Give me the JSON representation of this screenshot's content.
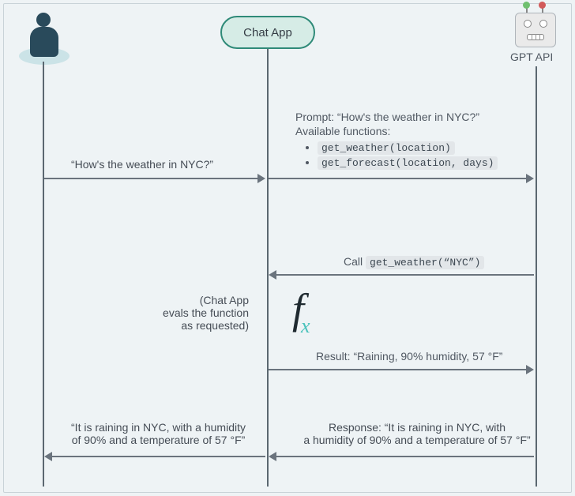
{
  "actors": {
    "user_label": "",
    "chat_app_label": "Chat App",
    "api_label": "GPT API"
  },
  "msg": {
    "user_to_app": "“How's the weather in NYC?”",
    "app_to_api_prompt": "Prompt: “How's the weather in NYC?”",
    "available_functions_label": "Available functions:",
    "func1": "get_weather(location)",
    "func2": "get_forecast(location, days)",
    "api_to_app_call_label": "Call",
    "api_to_app_call_code": "get_weather(“NYC”)",
    "eval_note_l1": "(Chat App",
    "eval_note_l2": "evals the function",
    "eval_note_l3": "as requested)",
    "result_text": "Result: “Raining, 90% humidity, 57 °F”",
    "response_l1": "Response: “It is raining in NYC, with",
    "response_l2": "a humidity of 90% and a temperature of 57 °F”",
    "final_l1": "“It is raining in NYC, with a humidity",
    "final_l2": "of 90% and a temperature of 57 °F”"
  },
  "fx": {
    "f": "f",
    "x": "x"
  }
}
